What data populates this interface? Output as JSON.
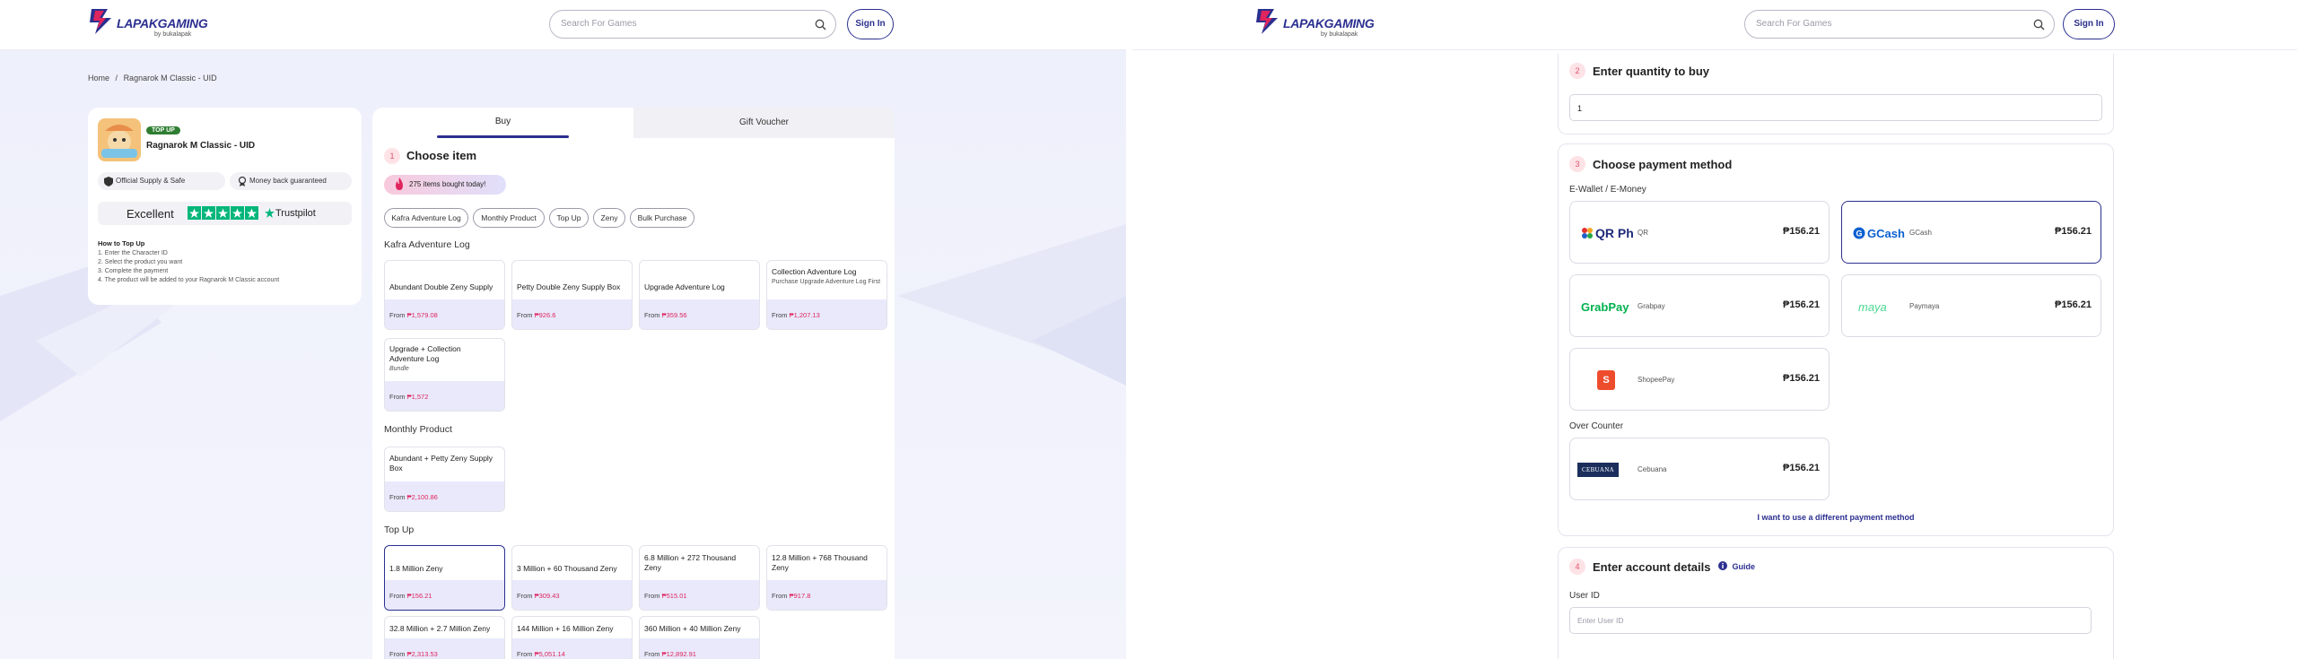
{
  "brand": {
    "name": "LAPAKGAMING",
    "sub": "by bukalapak"
  },
  "search": {
    "placeholder": "Search For Games"
  },
  "header": {
    "signin": "Sign In"
  },
  "breadcrumb": {
    "home": "Home",
    "sep": "/",
    "current": "Ragnarok M Classic - UID"
  },
  "game": {
    "badge": "TOP UP",
    "title": "Ragnarok M Classic - UID",
    "feature1": "Official Supply & Safe",
    "feature2": "Money back guaranteed",
    "trust_excellent": "Excellent",
    "trust_brand": "Trustpilot",
    "howto_title": "How to Top Up",
    "howto": [
      "1. Enter the Character ID",
      "2. Select the product you want",
      "3. Complete the payment",
      "4. The product will be added to your Ragnarok M Classic account"
    ]
  },
  "tabs": {
    "buy": "Buy",
    "gift": "Gift Voucher"
  },
  "choose": {
    "step": "1",
    "title": "Choose item",
    "bought": "275 items bought today!",
    "filters": [
      "Kafra Adventure Log",
      "Monthly Product",
      "Top Up",
      "Zeny",
      "Bulk Purchase"
    ],
    "groups": {
      "kafra": "Kafra Adventure Log",
      "monthly": "Monthly Product",
      "topup": "Top Up"
    },
    "kafra_items": [
      {
        "name": "Abundant Double Zeny Supply",
        "sub": "",
        "price": "₱1,579.08"
      },
      {
        "name": "Petty Double Zeny Supply Box",
        "sub": "",
        "price": "₱926.6"
      },
      {
        "name": "Upgrade Adventure Log",
        "sub": "",
        "price": "₱359.56"
      },
      {
        "name": "Collection Adventure Log",
        "sub": "Purchase Upgrade Adventure Log First",
        "price": "₱1,207.13"
      },
      {
        "name": "Upgrade + Collection Adventure Log",
        "sub": "Bundle",
        "price": "₱1,572"
      }
    ],
    "monthly_items": [
      {
        "name": "Abundant + Petty Zeny Supply Box",
        "sub": "",
        "price": "₱2,100.86"
      }
    ],
    "topup_items": [
      {
        "name": "1.8 Million Zeny",
        "sub": "",
        "price": "₱156.21"
      },
      {
        "name": "3 Million + 60 Thousand Zeny",
        "sub": "",
        "price": "₱309.43"
      },
      {
        "name": "6.8 Million + 272 Thousand Zeny",
        "sub": "",
        "price": "₱515.01"
      },
      {
        "name": "12.8 Million + 768 Thousand Zeny",
        "sub": "",
        "price": "₱917.8"
      },
      {
        "name": "32.8 Million + 2.7 Million Zeny",
        "sub": "",
        "price": "₱2,313.53"
      },
      {
        "name": "144 Million + 16 Million Zeny",
        "sub": "",
        "price": "₱5,051.14"
      },
      {
        "name": "360 Million + 40 Million Zeny",
        "sub": "",
        "price": "₱12,892.91"
      }
    ],
    "from": "From"
  },
  "quantity": {
    "step": "2",
    "title": "Enter quantity to buy",
    "value": "1"
  },
  "payment": {
    "step": "3",
    "title": "Choose payment method",
    "ewallet": "E-Wallet / E-Money",
    "over_counter": "Over Counter",
    "methods": [
      {
        "name": "QR",
        "logo": "QR Ph",
        "price": "₱156.21"
      },
      {
        "name": "GCash",
        "logo": "GCash",
        "price": "₱156.21"
      },
      {
        "name": "Grabpay",
        "logo": "GrabPay",
        "price": "₱156.21"
      },
      {
        "name": "Paymaya",
        "logo": "maya",
        "price": "₱156.21"
      },
      {
        "name": "ShopeePay",
        "logo": "S",
        "price": "₱156.21"
      },
      {
        "name": "Cebuana",
        "logo": "CEBUANA",
        "price": "₱156.21"
      }
    ],
    "different": "I want to use a different payment method"
  },
  "account": {
    "step": "4",
    "title": "Enter account details",
    "guide": "Guide",
    "userid_label": "User ID",
    "userid_placeholder": "Enter User ID"
  },
  "colors": {
    "brand": "#2b2f8f",
    "price": "#e0245e",
    "accent_bg": "#e9e9fb"
  }
}
